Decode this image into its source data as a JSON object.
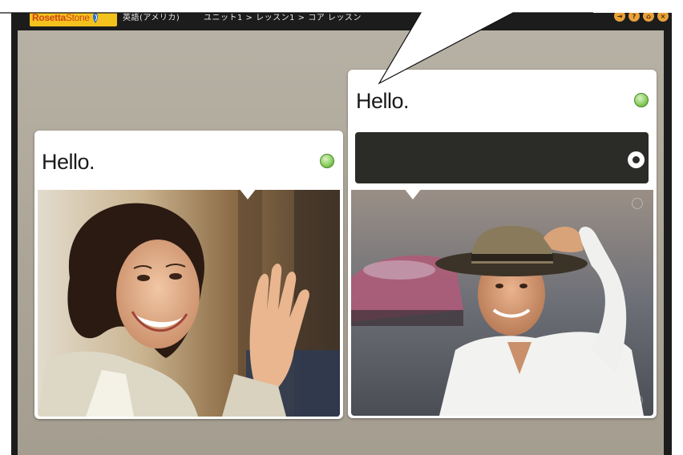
{
  "app": {
    "logo_bold": "Rosetta",
    "logo_light": "Stone",
    "language": "英語(アメリカ)",
    "breadcrumb": "ユニット1 > レッスン1 > コア レッスン"
  },
  "toolbar_icons": [
    "exit-icon",
    "settings-icon",
    "home-icon",
    "close-icon"
  ],
  "cards": [
    {
      "prompt": "Hello.",
      "photo": "woman waving"
    },
    {
      "prompt": "Hello.",
      "answer": "",
      "photo": "man in hat"
    }
  ],
  "colors": {
    "frame": "#1c1c1c",
    "logo_bg": "#f3c21c",
    "logo_text": "#d0441a",
    "audio_green": "#8fcf63",
    "answer_box": "#2b2b27",
    "stage": "#aca597"
  }
}
